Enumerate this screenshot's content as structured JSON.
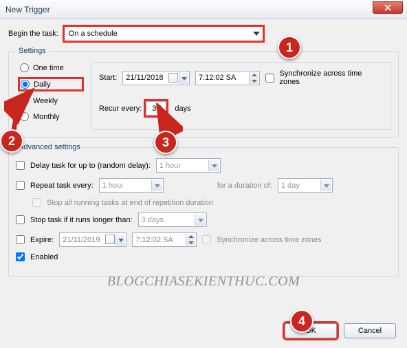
{
  "window": {
    "title": "New Trigger"
  },
  "begin_label": "Begin the task:",
  "begin_value": "On a schedule",
  "settings_legend": "Settings",
  "schedule": {
    "options": {
      "one_time": "One time",
      "daily": "Daily",
      "weekly": "Weekly",
      "monthly": "Monthly"
    },
    "start_label": "Start:",
    "start_date": "21/11/2018",
    "start_time": "7:12:02 SA",
    "sync_label": "Synchronize across time zones",
    "recur_label": "Recur every:",
    "recur_value": "30",
    "recur_unit": "days"
  },
  "advanced": {
    "legend": "Advanced settings",
    "delay_label": "Delay task for up to (random delay):",
    "delay_value": "1 hour",
    "repeat_label": "Repeat task every:",
    "repeat_value": "1 hour",
    "duration_label": "for a duration of:",
    "duration_value": "1 day",
    "stop_repeat_label": "Stop all running tasks at end of repetition duration",
    "stop_long_label": "Stop task if it runs longer than:",
    "stop_long_value": "3 days",
    "expire_label": "Expire:",
    "expire_date": "21/11/2019",
    "expire_time": "7:12:02 SA",
    "expire_sync_label": "Synchronize across time zones",
    "enabled_label": "Enabled"
  },
  "buttons": {
    "ok": "OK",
    "cancel": "Cancel"
  },
  "annotations": {
    "b1": "1",
    "b2": "2",
    "b3": "3",
    "b4": "4"
  },
  "watermark": "BLOGCHIASEKIENTHUC.COM"
}
